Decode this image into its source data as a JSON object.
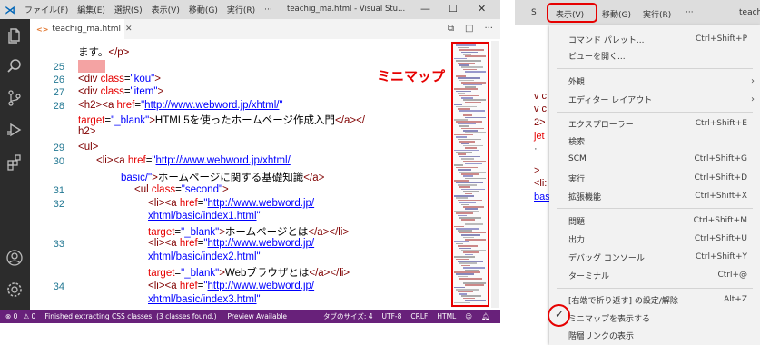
{
  "titlebar": {
    "menus": [
      "ファイル(F)",
      "編集(E)",
      "選択(S)",
      "表示(V)",
      "移動(G)",
      "実行(R)",
      "···"
    ],
    "title": "teachig_ma.html - Visual Stu...",
    "minimize": "—",
    "restore": "☐",
    "close": "✕"
  },
  "tab": {
    "icon": "<>",
    "label": "teachig_ma.html",
    "close": "✕"
  },
  "editor": {
    "lines": [
      {
        "num": "",
        "html": "<span class=\"x\">ます。</span><span class=\"t\">&lt;/p&gt;</span>"
      },
      {
        "num": "25",
        "html": ""
      },
      {
        "num": "26",
        "html": "<span class=\"t\">&lt;div </span><span class=\"a\">class</span><span class=\"x\">=</span><span class=\"v\">\"kou\"</span><span class=\"t\">&gt;</span>"
      },
      {
        "num": "27",
        "html": "<span class=\"t\">&lt;div </span><span class=\"a\">class</span><span class=\"x\">=</span><span class=\"v\">\"item\"</span><span class=\"t\">&gt;</span>"
      },
      {
        "num": "28",
        "html": "<span class=\"t\">&lt;h2&gt;&lt;a </span><span class=\"a\">href</span><span class=\"x\">=</span><span class=\"v\">\"</span><span class=\"u\">http://www.webword.jp/xhtml/</span><span class=\"v\">\"</span>"
      },
      {
        "num": "",
        "html": "<span class=\"a\">target</span><span class=\"x\">=</span><span class=\"v\">\"_blank\"</span><span class=\"t\">&gt;</span><span class=\"x\">HTML5を使ったホームページ作成入門</span><span class=\"t\">&lt;/a&gt;&lt;/</span>"
      },
      {
        "num": "",
        "html": "<span class=\"t\">h2&gt;</span>"
      },
      {
        "num": "29",
        "html": "<span class=\"t\">&lt;ul&gt;</span>"
      },
      {
        "num": "30",
        "html": "<span class=\"t\">&lt;li&gt;&lt;a </span><span class=\"a\">href</span><span class=\"x\">=</span><span class=\"v\">\"</span><span class=\"u\">http://www.webword.jp/xhtml/</span>"
      },
      {
        "num": "",
        "html": "<span class=\"u\">basic/</span><span class=\"v\">\"</span><span class=\"t\">&gt;</span><span class=\"x\">ホームページに関する基礎知識</span><span class=\"t\">&lt;/a&gt;</span>"
      },
      {
        "num": "31",
        "html": "<span class=\"t\">&lt;ul </span><span class=\"a\">class</span><span class=\"x\">=</span><span class=\"v\">\"second\"</span><span class=\"t\">&gt;</span>"
      },
      {
        "num": "32",
        "html": "<span class=\"t\">&lt;li&gt;&lt;a </span><span class=\"a\">href</span><span class=\"x\">=</span><span class=\"v\">\"</span><span class=\"u\">http://www.webword.jp/</span>"
      },
      {
        "num": "",
        "html": "<span class=\"u\">xhtml/basic/index1.html</span><span class=\"v\">\"</span>"
      },
      {
        "num": "",
        "html": "<span class=\"a\">target</span><span class=\"x\">=</span><span class=\"v\">\"_blank\"</span><span class=\"t\">&gt;</span><span class=\"x\">ホームページとは</span><span class=\"t\">&lt;/a&gt;&lt;/li&gt;</span>"
      },
      {
        "num": "33",
        "html": "<span class=\"t\">&lt;li&gt;&lt;a </span><span class=\"a\">href</span><span class=\"x\">=</span><span class=\"v\">\"</span><span class=\"u\">http://www.webword.jp/</span>"
      },
      {
        "num": "",
        "html": "<span class=\"u\">xhtml/basic/index2.html</span><span class=\"v\">\"</span>"
      },
      {
        "num": "",
        "html": "<span class=\"a\">target</span><span class=\"x\">=</span><span class=\"v\">\"_blank\"</span><span class=\"t\">&gt;</span><span class=\"x\">Webブラウザとは</span><span class=\"t\">&lt;/a&gt;&lt;/li&gt;</span>"
      },
      {
        "num": "34",
        "html": "<span class=\"t\">&lt;li&gt;&lt;a </span><span class=\"a\">href</span><span class=\"x\">=</span><span class=\"v\">\"</span><span class=\"u\">http://www.webword.jp/</span>"
      },
      {
        "num": "",
        "html": "<span class=\"u\">xhtml/basic/index3.html</span><span class=\"v\">\"</span>"
      }
    ]
  },
  "annotation": {
    "minimap_label": "ミニマップ"
  },
  "statusbar": {
    "errors": "⊗ 0",
    "warnings": "⚠ 0",
    "message": "Finished extracting CSS classes. (3 classes found.)",
    "preview": "Preview Available",
    "tab_size": "タブのサイズ: 4",
    "encoding": "UTF-8",
    "eol": "CRLF",
    "language": "HTML"
  },
  "right_panel": {
    "menubar": [
      "S",
      "表示(V)",
      "移動(G)",
      "実行(R)",
      "···",
      "teach"
    ],
    "editor_fragments": [
      "v c",
      "v c",
      "2>",
      "jet",
      "·",
      ">",
      "<li:",
      "bas"
    ],
    "menu_items": [
      {
        "label": "コマンド パレット...",
        "shortcut": "Ctrl+Shift+P"
      },
      {
        "label": "ビューを開く...",
        "shortcut": ""
      },
      {
        "label": "外観",
        "shortcut": "",
        "arrow": "›"
      },
      {
        "label": "エディター レイアウト",
        "shortcut": "",
        "arrow": "›"
      },
      {
        "label": "エクスプローラー",
        "shortcut": "Ctrl+Shift+E"
      },
      {
        "label": "検索",
        "shortcut": ""
      },
      {
        "label": "SCM",
        "shortcut": "Ctrl+Shift+G"
      },
      {
        "label": "実行",
        "shortcut": "Ctrl+Shift+D"
      },
      {
        "label": "拡張機能",
        "shortcut": "Ctrl+Shift+X"
      },
      {
        "label": "問題",
        "shortcut": "Ctrl+Shift+M"
      },
      {
        "label": "出力",
        "shortcut": "Ctrl+Shift+U"
      },
      {
        "label": "デバッグ コンソール",
        "shortcut": "Ctrl+Shift+Y"
      },
      {
        "label": "ターミナル",
        "shortcut": "Ctrl+@"
      },
      {
        "label": "[右端で折り返す] の設定/解除",
        "shortcut": "Alt+Z"
      },
      {
        "label": "ミニマップを表示する",
        "shortcut": "",
        "checked": true
      },
      {
        "label": "階層リンクの表示",
        "shortcut": ""
      }
    ],
    "check_mark": "✓"
  },
  "colors": {
    "activity_bar": "#2c2c2c",
    "statusbar": "#68217a",
    "highlight_red": "#e60000",
    "tag": "#800000",
    "attribute": "#e50000",
    "string": "#0000ff",
    "line_number": "#237893"
  }
}
